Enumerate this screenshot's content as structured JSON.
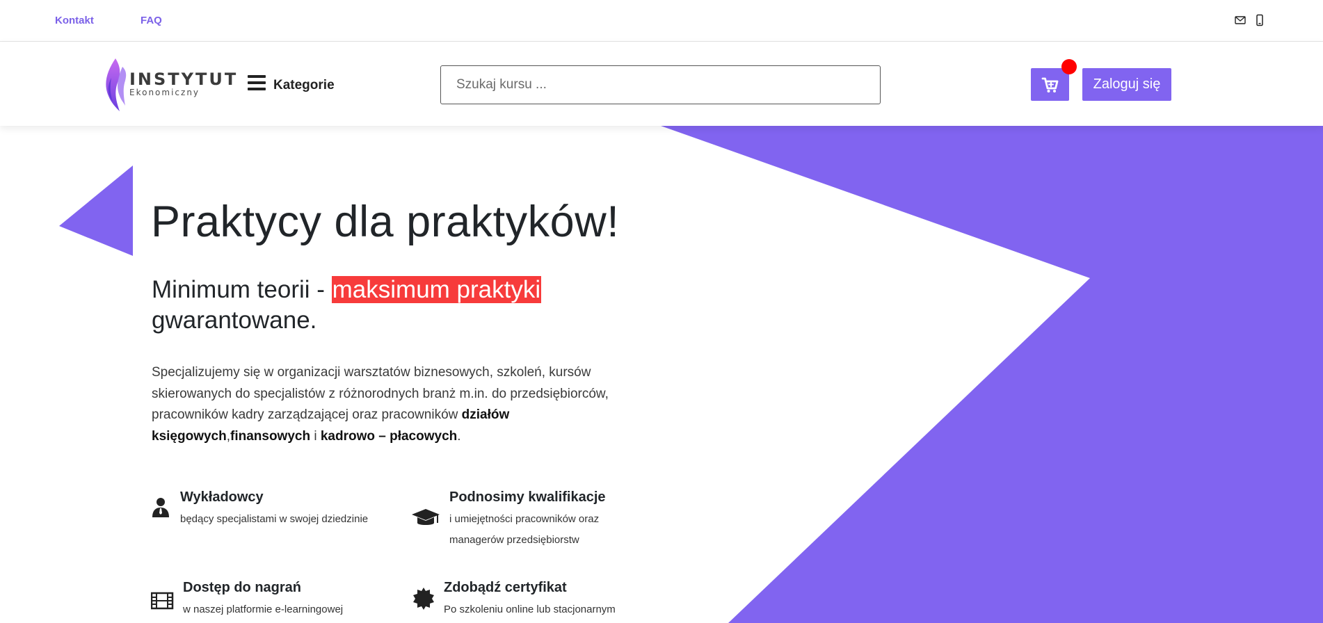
{
  "colors": {
    "accent": "#8164f0",
    "highlight": "#f73b3b",
    "notification": "#ff0000"
  },
  "topbar": {
    "links": [
      "Kontakt",
      "FAQ"
    ],
    "icons": [
      "mail-icon",
      "phone-icon"
    ]
  },
  "header": {
    "logo": {
      "main": "INSTYTUT",
      "sub": "Ekonomiczny"
    },
    "menu_label": "Kategorie",
    "search_placeholder": "Szukaj kursu ...",
    "login_label": "Zaloguj się"
  },
  "hero": {
    "title": "Praktycy dla praktyków!",
    "subtitle_start": "Minimum teorii - ",
    "subtitle_highlight": "maksimum praktyki",
    "subtitle_end": "gwarantowane.",
    "description_plain": "Specjalizujemy się w organizacji warsztatów biznesowych, szkoleń, kursów skierowanych do specjalistów z różnorodnych branż m.in. do przedsiębiorców, pracowników kadry zarządzającej oraz pracowników ",
    "description_bold_1": "działów księgowych",
    "description_sep_1": ",",
    "description_bold_2": "finansowych",
    "description_sep_2": " i ",
    "description_bold_3": "kadrowo – płacowych",
    "description_end": "."
  },
  "features": [
    {
      "title": "Wykładowcy",
      "text_lines": [
        "będący specjalistami w swojej dziedzinie"
      ],
      "icon": "person-icon"
    },
    {
      "title": "Podnosimy kwalifikacje",
      "text_lines": [
        "i umiejętności pracowników oraz",
        "managerów przedsiębiorstw"
      ],
      "icon": "graduation-cap-icon"
    },
    {
      "title": "Dostęp do nagrań",
      "text_lines": [
        "w naszej platformie e-learningowej"
      ],
      "icon": "film-icon"
    },
    {
      "title": "Zdobądź certyfikat",
      "text_lines": [
        "Po szkoleniu online lub stacjonarnym"
      ],
      "icon": "certificate-icon"
    }
  ]
}
